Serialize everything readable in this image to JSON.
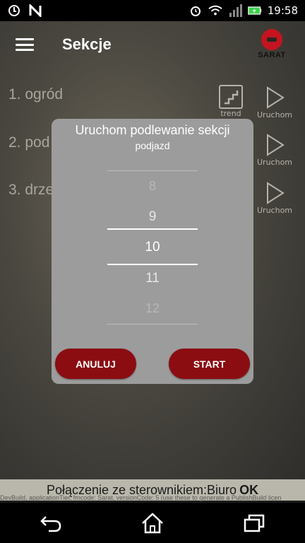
{
  "statusbar": {
    "time": "19:58",
    "icons": [
      "sync-icon",
      "n-icon",
      "alarm-icon",
      "wifi-icon",
      "signal-icon",
      "battery-charging-icon"
    ]
  },
  "appbar": {
    "title": "Sekcje",
    "logo_text": "SARAT"
  },
  "sections": [
    {
      "label": "1. ogród",
      "has_trend": true
    },
    {
      "label": "2. pod"
    },
    {
      "label": "3. drze"
    }
  ],
  "actions": {
    "trend_label": "trend",
    "run_label": "Uruchom"
  },
  "dialog": {
    "title": "Uruchom podlewanie sekcji",
    "subtitle": "podjazd",
    "picker_values": [
      "8",
      "9",
      "10",
      "11",
      "12"
    ],
    "selected": "10",
    "cancel_label": "ANULUJ",
    "start_label": "START"
  },
  "connection": {
    "text": "Połączenie ze sterownikiem:Biuro",
    "status": "OK"
  },
  "devbuild": "DevBuild, applicationTier, fmcode: Sarat, versionCode: 5 (use these to generate a PublishBuild licen",
  "colors": {
    "accent_red": "#8b0d12",
    "dialog_bg": "#9c9c9c",
    "connbar_bg": "#b9b7ab"
  }
}
